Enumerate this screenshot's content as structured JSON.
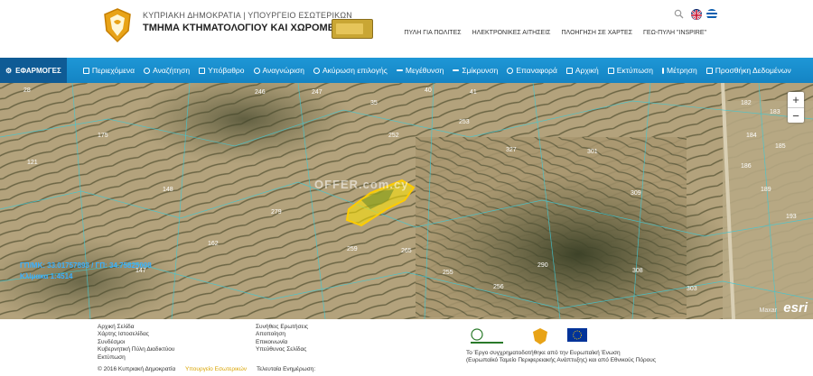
{
  "header": {
    "gov_line": "ΚΥΠΡΙΑΚΗ ΔΗΜΟΚΡΑΤΙΑ | ΥΠΟΥΡΓΕΙΟ ΕΣΩΤΕΡΙΚΩΝ",
    "department": "ΤΜΗΜΑ ΚΤΗΜΑΤΟΛΟΓΙΟΥ ΚΑΙ ΧΩΡΟΜΕΤΡΙΑΣ",
    "nav": [
      "ΠΥΛΗ ΓΙΑ ΠΟΛΙΤΕΣ",
      "ΗΛΕΚΤΡΟΝΙΚΕΣ ΑΙΤΗΣΕΙΣ",
      "ΠΛΟΗΓΗΣΗ ΣΕ ΧΑΡΤΕΣ",
      "ΓΕΩ-ΠΥΛΗ \"INSPIRE\""
    ]
  },
  "toolbar": {
    "apps_label": "ΕΦΑΡΜΟΓΕΣ",
    "tools": [
      {
        "label": "Περιεχόμενα",
        "icon": "list-icon"
      },
      {
        "label": "Αναζήτηση",
        "icon": "search-icon"
      },
      {
        "label": "Υπόβαθρο",
        "icon": "grid-icon"
      },
      {
        "label": "Αναγνώριση",
        "icon": "info-icon"
      },
      {
        "label": "Ακύρωση επιλογής",
        "icon": "cancel-icon"
      },
      {
        "label": "Μεγέθυνση",
        "icon": "plus-icon"
      },
      {
        "label": "Σμίκρυνση",
        "icon": "minus-icon"
      },
      {
        "label": "Επαναφορά",
        "icon": "reset-icon"
      },
      {
        "label": "Αρχική",
        "icon": "home-icon"
      },
      {
        "label": "Εκτύπωση",
        "icon": "print-icon"
      },
      {
        "label": "Μέτρηση",
        "icon": "ruler-icon"
      },
      {
        "label": "Προσθήκη Δεδομένων",
        "icon": "add-data-icon"
      }
    ]
  },
  "map": {
    "zoom_in": "+",
    "zoom_out": "−",
    "coords": "ΓΠ/ΜΚ: 33.01757893 / ΓΠ: 34.75825008",
    "scale": "Κλίμακα 1:4514",
    "esri": "esri",
    "maxar": "Maxar",
    "watermark": "OFFER.com.cy",
    "parcel_labels": [
      "28",
      "247",
      "246",
      "253",
      "279",
      "255",
      "256",
      "290",
      "308",
      "309",
      "301",
      "327",
      "182",
      "183",
      "184",
      "185",
      "186",
      "189",
      "193",
      "121",
      "175",
      "148",
      "162",
      "147",
      "40",
      "35",
      "41",
      "252",
      "259",
      "265",
      "303"
    ]
  },
  "footer": {
    "col1": [
      "Αρχική Σελίδα",
      "Χάρτης Ιστοσελίδας",
      "Συνδέσμοι",
      "Κυβερνητική Πύλη Διαδικτύου",
      "Εκτύπωση"
    ],
    "col2": [
      "Συνήθεις Ερωτήσεις",
      "Αποποίηση",
      "Επικοινωνία",
      "Υπεύθυνος Σελίδας"
    ],
    "copyright": "© 2016 Κυπριακή Δημοκρατία",
    "link": "Υπουργείο Εσωτερικών",
    "updated": "Τελευταία Ενημέρωση:",
    "eu_text": [
      "Το Έργο συγχρηματοδοτήθηκε από την Ευρωπαϊκή Ένωση",
      "(Ευρωπαϊκό Ταμείο Περιφερειακής Ανάπτυξης) και από Εθνικούς Πόρους"
    ]
  },
  "colors": {
    "toolbar": "#1a8fd0",
    "apps": "#0f5b95",
    "highlight_parcel": "#ffe600",
    "coords_text": "#3ab0ff"
  }
}
